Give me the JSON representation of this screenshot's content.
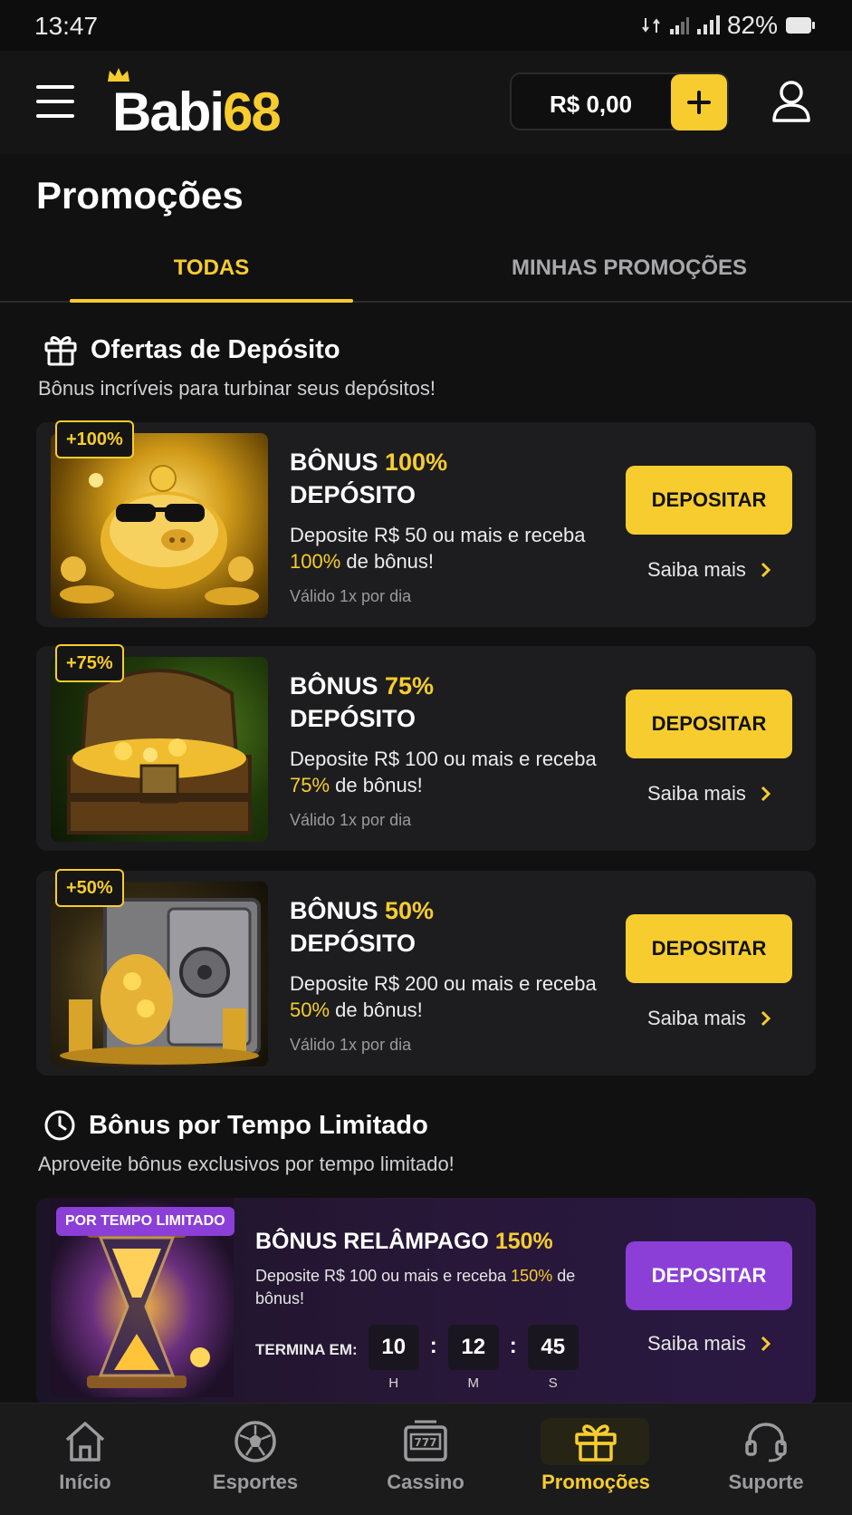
{
  "status_bar": {
    "time": "13:47",
    "battery": "82%"
  },
  "header": {
    "logo_main": "Babi",
    "logo_accent": "68",
    "balance": "R$ 0,00"
  },
  "page": {
    "title": "Promoções"
  },
  "tabs": [
    {
      "label": "TODAS",
      "active": true
    },
    {
      "label": "MINHAS PROMOÇÕES",
      "active": false
    }
  ],
  "deposit_section": {
    "title": "Ofertas de Depósito",
    "subtitle": "Bônus incríveis para turbinar seus depósitos!"
  },
  "offers": [
    {
      "badge": "+100%",
      "title_pre": "BÔNUS ",
      "title_hl": "100%",
      "title_post": "DEPÓSITO",
      "desc_pre": "Deposite R$ 50 ou mais e receba ",
      "desc_hl": "100%",
      "desc_post": " de bônus!",
      "valid": "Válido 1x por dia",
      "button": "DEPOSITAR",
      "more": "Saiba mais",
      "image": "golden-piggy-bank"
    },
    {
      "badge": "+75%",
      "title_pre": "BÔNUS ",
      "title_hl": "75%",
      "title_post": "DEPÓSITO",
      "desc_pre": "Deposite R$ 100 ou mais e receba ",
      "desc_hl": "75%",
      "desc_post": " de bônus!",
      "valid": "Válido 1x por dia",
      "button": "DEPOSITAR",
      "more": "Saiba mais",
      "image": "treasure-chest"
    },
    {
      "badge": "+50%",
      "title_pre": "BÔNUS ",
      "title_hl": "50%",
      "title_post": "DEPÓSITO",
      "desc_pre": "Deposite R$ 200 ou mais e receba ",
      "desc_hl": "50%",
      "desc_post": " de bônus!",
      "valid": "Válido 1x por dia",
      "button": "DEPOSITAR",
      "more": "Saiba mais",
      "image": "vault-with-coins"
    }
  ],
  "limited_section": {
    "title": "Bônus por Tempo Limitado",
    "subtitle": "Aproveite bônus exclusivos por tempo limitado!"
  },
  "limited_offer": {
    "badge": "POR TEMPO LIMITADO",
    "title_pre": "BÔNUS RELÂMPAGO ",
    "title_hl": "150%",
    "desc_pre": "Deposite R$ 100 ou mais e receba ",
    "desc_hl": "150%",
    "desc_post": " de bônus!",
    "countdown_label": "TERMINA EM:",
    "hours": "10",
    "minutes": "12",
    "seconds": "45",
    "unit_h": "H",
    "unit_m": "M",
    "unit_s": "S",
    "separator": ":",
    "button": "DEPOSITAR",
    "more": "Saiba mais",
    "image": "hourglass"
  },
  "bottom_nav": [
    {
      "label": "Início",
      "icon": "home-icon",
      "active": false
    },
    {
      "label": "Esportes",
      "icon": "soccer-ball-icon",
      "active": false
    },
    {
      "label": "Cassino",
      "icon": "slot-machine-icon",
      "active": false
    },
    {
      "label": "Promoções",
      "icon": "gift-icon",
      "active": true
    },
    {
      "label": "Suporte",
      "icon": "headset-icon",
      "active": false
    }
  ],
  "colors": {
    "accent": "#f7cc2f",
    "purple": "#8b3fd6",
    "background": "#111112",
    "card": "#1d1d1f"
  }
}
